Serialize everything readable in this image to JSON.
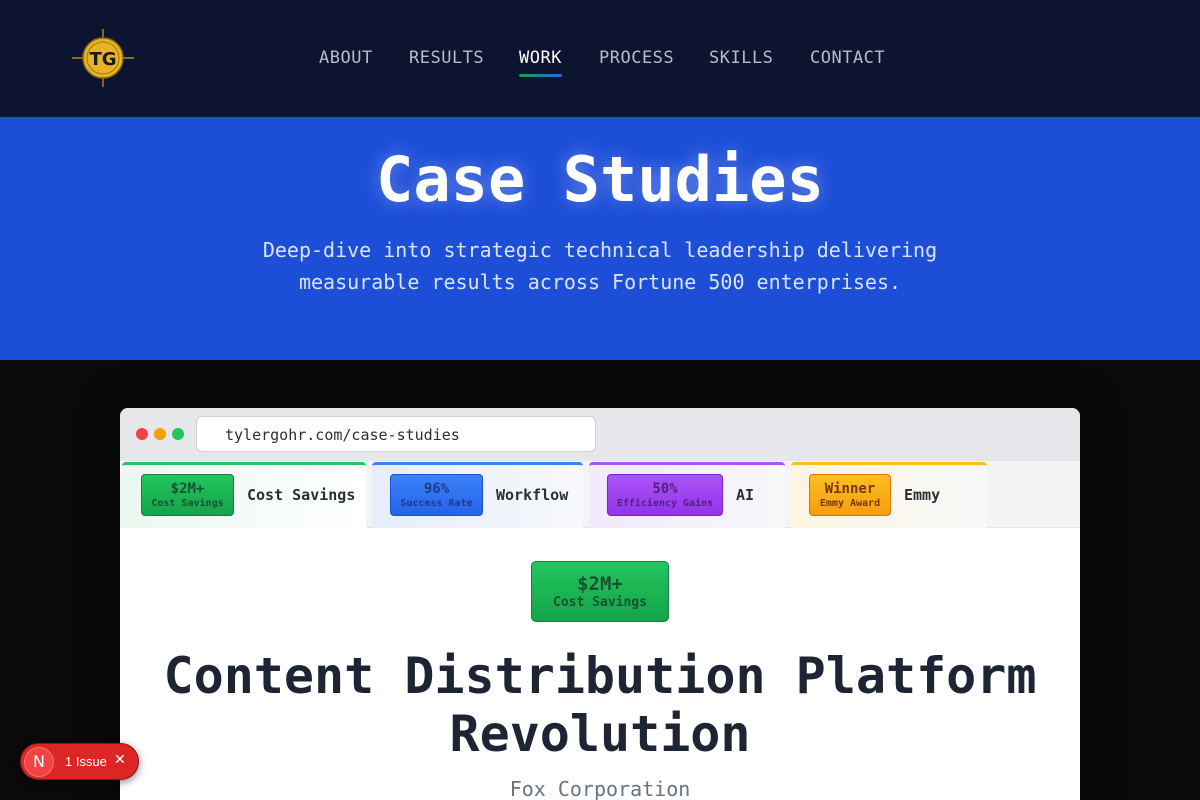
{
  "header": {
    "logo_text": "TG",
    "nav": [
      {
        "label": "ABOUT",
        "active": false
      },
      {
        "label": "RESULTS",
        "active": false
      },
      {
        "label": "WORK",
        "active": true
      },
      {
        "label": "PROCESS",
        "active": false
      },
      {
        "label": "SKILLS",
        "active": false
      },
      {
        "label": "CONTACT",
        "active": false
      }
    ]
  },
  "hero": {
    "title": "Case Studies",
    "subtitle_line1": "Deep-dive into strategic technical leadership delivering",
    "subtitle_line2": "measurable results across Fortune 500 enterprises."
  },
  "browser": {
    "url": "tylergohr.com/case-studies",
    "tabs": [
      {
        "badge_value": "$2M+",
        "badge_label": "Cost Savings",
        "label": "Cost Savings",
        "accent": "#22c55e",
        "active": true
      },
      {
        "badge_value": "96%",
        "badge_label": "Success Rate",
        "label": "Workflow",
        "accent": "#3b82f6",
        "active": false
      },
      {
        "badge_value": "50%",
        "badge_label": "Efficiency Gains",
        "label": "AI",
        "accent": "#a855f7",
        "active": false
      },
      {
        "badge_value": "Winner",
        "badge_label": "Emmy Award",
        "label": "Emmy",
        "accent": "#fbbf24",
        "active": false
      }
    ]
  },
  "case": {
    "badge_value": "$2M+",
    "badge_label": "Cost Savings",
    "title_line1": "Content Distribution Platform",
    "title_line2": "Revolution",
    "company": "Fox Corporation"
  },
  "issue_indicator": {
    "logo_letter": "N",
    "text": "1 Issue"
  },
  "colors": {
    "header_bg": "#0c1430",
    "hero_bg": "#1d4ed8",
    "page_bg": "#0a0a0a",
    "success": "#22c55e",
    "issue_red": "#dc2626"
  }
}
